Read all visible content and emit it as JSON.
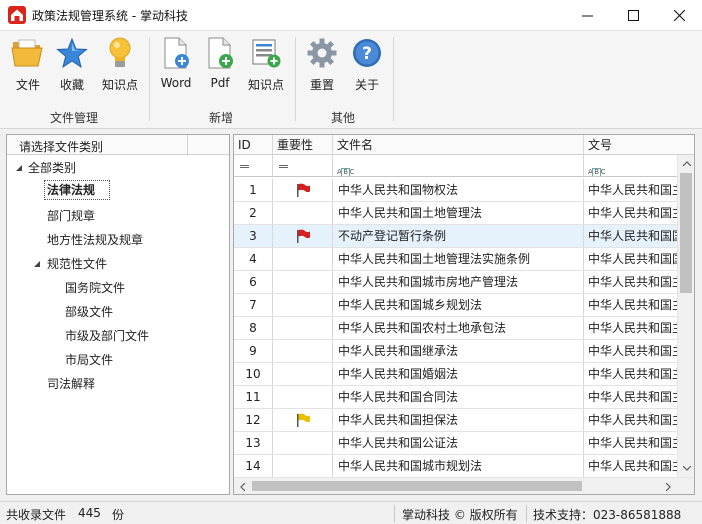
{
  "window": {
    "title": "政策法规管理系统 - 掌动科技"
  },
  "ribbon": {
    "groups": [
      {
        "label": "文件管理",
        "buttons": [
          {
            "label": "文件",
            "icon": "folder-open-icon"
          },
          {
            "label": "收藏",
            "icon": "star-icon"
          },
          {
            "label": "知识点",
            "icon": "lightbulb-icon"
          }
        ]
      },
      {
        "label": "新增",
        "buttons": [
          {
            "label": "Word",
            "icon": "document-add-icon"
          },
          {
            "label": "Pdf",
            "icon": "pdf-add-icon"
          },
          {
            "label": "知识点",
            "icon": "list-add-icon"
          }
        ]
      },
      {
        "label": "其他",
        "buttons": [
          {
            "label": "重置",
            "icon": "gear-icon"
          },
          {
            "label": "关于",
            "icon": "help-icon"
          }
        ]
      }
    ]
  },
  "category_panel": {
    "header": "请选择文件类别",
    "items": [
      {
        "label": "全部类别",
        "level": 0,
        "expanded": true
      },
      {
        "label": "法律法规",
        "level": 1,
        "selected": true
      },
      {
        "label": "部门规章",
        "level": 1
      },
      {
        "label": "地方性法规及规章",
        "level": 1
      },
      {
        "label": "规范性文件",
        "level": 1,
        "expanded": true
      },
      {
        "label": "国务院文件",
        "level": 2
      },
      {
        "label": "部级文件",
        "level": 2
      },
      {
        "label": "市级及部门文件",
        "level": 2
      },
      {
        "label": "市局文件",
        "level": 2
      },
      {
        "label": "司法解释",
        "level": 1
      }
    ]
  },
  "grid": {
    "columns": {
      "id": "ID",
      "importance": "重要性",
      "name": "文件名",
      "doc_number": "文号"
    },
    "rows": [
      {
        "id": "1",
        "flag": "red",
        "name": "中华人民共和国物权法",
        "doc_number": "中华人民共和国主"
      },
      {
        "id": "2",
        "flag": "",
        "name": "中华人民共和国土地管理法",
        "doc_number": "中华人民共和国主"
      },
      {
        "id": "3",
        "flag": "red",
        "name": "不动产登记暂行条例",
        "doc_number": "中华人民共和国国",
        "selected": true
      },
      {
        "id": "4",
        "flag": "",
        "name": "中华人民共和国土地管理法实施条例",
        "doc_number": "中华人民共和国国"
      },
      {
        "id": "6",
        "flag": "",
        "name": "中华人民共和国城市房地产管理法",
        "doc_number": "中华人民共和国主"
      },
      {
        "id": "7",
        "flag": "",
        "name": "中华人民共和国城乡规划法",
        "doc_number": "中华人民共和国主"
      },
      {
        "id": "8",
        "flag": "",
        "name": "中华人民共和国农村土地承包法",
        "doc_number": "中华人民共和国主"
      },
      {
        "id": "9",
        "flag": "",
        "name": "中华人民共和国继承法",
        "doc_number": "中华人民共和国主"
      },
      {
        "id": "10",
        "flag": "",
        "name": "中华人民共和国婚姻法",
        "doc_number": "中华人民共和国主"
      },
      {
        "id": "11",
        "flag": "",
        "name": "中华人民共和国合同法",
        "doc_number": "中华人民共和国主"
      },
      {
        "id": "12",
        "flag": "yellow",
        "name": "中华人民共和国担保法",
        "doc_number": "中华人民共和国主"
      },
      {
        "id": "13",
        "flag": "",
        "name": "中华人民共和国公证法",
        "doc_number": "中华人民共和国主"
      },
      {
        "id": "14",
        "flag": "",
        "name": "中华人民共和国城市规划法",
        "doc_number": "中华人民共和国主"
      }
    ]
  },
  "status": {
    "count_label": "共收录文件",
    "count": "445",
    "count_unit": "份",
    "copyright": "掌动科技 © 版权所有",
    "support": "技术支持：023-86581888"
  },
  "colors": {
    "red_flag": "#d42020",
    "yellow_flag": "#e8c000",
    "selection": "#e5f1fb",
    "accent": "#2f6db5"
  }
}
